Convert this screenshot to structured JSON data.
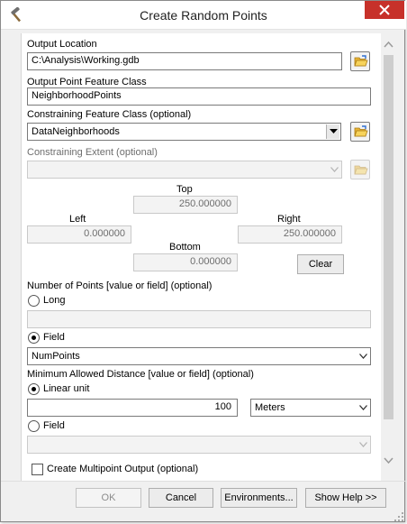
{
  "window": {
    "title": "Create Random Points",
    "app_icon": "hammer-icon",
    "close_icon": "close-icon"
  },
  "output_location": {
    "label": "Output Location",
    "value": "C:\\Analysis\\Working.gdb",
    "browse_icon": "folder-open-icon"
  },
  "output_feature_class": {
    "label": "Output Point Feature Class",
    "value": "NeighborhoodPoints"
  },
  "constraining_feature_class": {
    "label": "Constraining Feature Class (optional)",
    "value": "DataNeighborhoods",
    "browse_icon": "folder-open-icon"
  },
  "constraining_extent": {
    "label": "Constraining Extent (optional)",
    "value": "",
    "top_label": "Top",
    "top_value": "250.000000",
    "left_label": "Left",
    "left_value": "0.000000",
    "right_label": "Right",
    "right_value": "250.000000",
    "bottom_label": "Bottom",
    "bottom_value": "0.000000",
    "clear_label": "Clear"
  },
  "number_of_points": {
    "label": "Number of Points [value or field] (optional)",
    "long_label": "Long",
    "long_value": "",
    "field_label": "Field",
    "field_value": "NumPoints",
    "selected": "Field"
  },
  "minimum_distance": {
    "label": "Minimum Allowed Distance [value or field] (optional)",
    "linear_label": "Linear unit",
    "linear_value": "100",
    "unit_value": "Meters",
    "field_label": "Field",
    "field_value": "",
    "selected": "Linear unit"
  },
  "multipoint": {
    "label": "Create Multipoint Output (optional)",
    "checked": false
  },
  "buttons": {
    "ok": "OK",
    "cancel": "Cancel",
    "environments": "Environments...",
    "show_help": "Show Help >>"
  }
}
